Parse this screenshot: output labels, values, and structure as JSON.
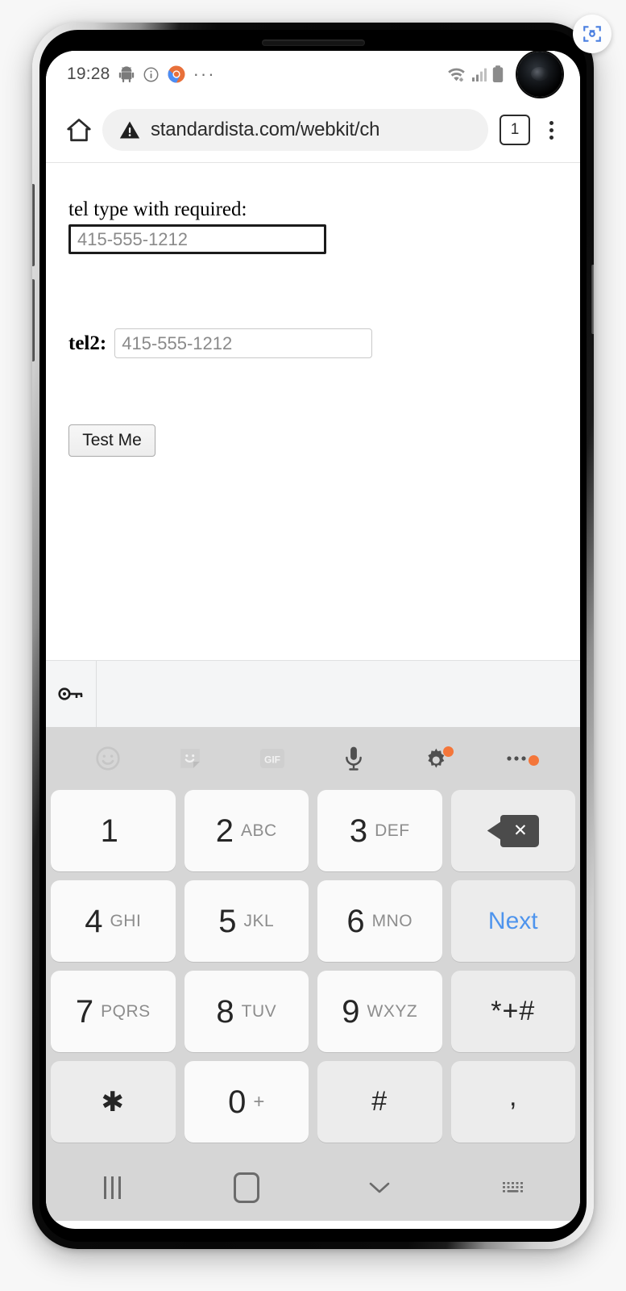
{
  "status_bar": {
    "time": "19:28",
    "left_icons": [
      "android-robot-icon",
      "info-circle-icon",
      "chrome-logo-icon",
      "overflow-dots-icon"
    ],
    "right_icons": [
      "wifi-icon",
      "cell-signal-icon",
      "battery-icon"
    ]
  },
  "browser": {
    "home_icon": "home-icon",
    "security_icon": "warning-triangle-icon",
    "url": "standardista.com/webkit/ch",
    "tab_count": "1",
    "menu_icon": "kebab-menu-icon"
  },
  "page": {
    "field1": {
      "label": "tel type with required:",
      "placeholder": "415-555-1212",
      "value": ""
    },
    "field2": {
      "label": "tel2:",
      "placeholder": "415-555-1212",
      "value": ""
    },
    "submit_label": "Test Me"
  },
  "autofill_bar": {
    "icon": "key-icon"
  },
  "keyboard": {
    "toolbar": [
      {
        "name": "emoji-icon",
        "badge": false
      },
      {
        "name": "sticker-icon",
        "badge": false
      },
      {
        "name": "gif-icon",
        "label": "GIF",
        "badge": false
      },
      {
        "name": "microphone-icon",
        "badge": false
      },
      {
        "name": "settings-gear-icon",
        "badge": true
      },
      {
        "name": "more-options-icon",
        "badge": true
      }
    ],
    "rows": [
      [
        {
          "type": "digit",
          "num": "1",
          "letters": ""
        },
        {
          "type": "digit",
          "num": "2",
          "letters": "ABC"
        },
        {
          "type": "digit",
          "num": "3",
          "letters": "DEF"
        },
        {
          "type": "backspace",
          "name": "backspace-key"
        }
      ],
      [
        {
          "type": "digit",
          "num": "4",
          "letters": "GHI"
        },
        {
          "type": "digit",
          "num": "5",
          "letters": "JKL"
        },
        {
          "type": "digit",
          "num": "6",
          "letters": "MNO"
        },
        {
          "type": "action",
          "label": "Next",
          "name": "next-key"
        }
      ],
      [
        {
          "type": "digit",
          "num": "7",
          "letters": "PQRS"
        },
        {
          "type": "digit",
          "num": "8",
          "letters": "TUV"
        },
        {
          "type": "digit",
          "num": "9",
          "letters": "WXYZ"
        },
        {
          "type": "symbol",
          "label": "*+#",
          "name": "symbols-key"
        }
      ],
      [
        {
          "type": "symbol",
          "label": "✱",
          "name": "asterisk-key"
        },
        {
          "type": "digit",
          "num": "0",
          "letters": "+"
        },
        {
          "type": "symbol",
          "label": "#",
          "name": "hash-key"
        },
        {
          "type": "comma",
          "label": ",",
          "name": "comma-key"
        }
      ]
    ]
  },
  "nav_bar": {
    "items": [
      "recents-icon",
      "home-icon",
      "hide-keyboard-icon",
      "keyboard-switch-icon"
    ]
  },
  "overlay": {
    "scan_button": "screenshot-scan-icon"
  },
  "colors": {
    "accent_blue": "#4e94ed",
    "badge_orange": "#f4763a",
    "keyboard_bg": "#d6d6d6",
    "key_face": "#fafafa"
  }
}
